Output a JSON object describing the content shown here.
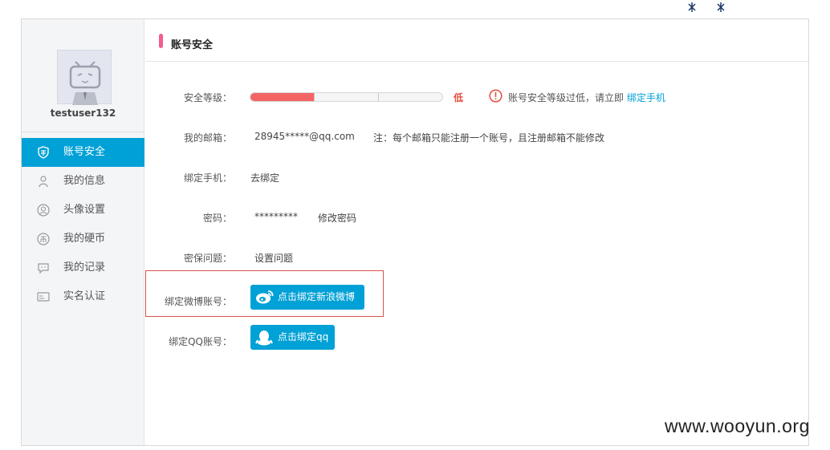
{
  "sidebar": {
    "username": "testuser132",
    "items": [
      {
        "label": "账号安全",
        "icon": "shield-icon",
        "active": true
      },
      {
        "label": "我的信息",
        "icon": "person-icon",
        "active": false
      },
      {
        "label": "头像设置",
        "icon": "avatar-icon",
        "active": false
      },
      {
        "label": "我的硬币",
        "icon": "coin-icon",
        "active": false
      },
      {
        "label": "我的记录",
        "icon": "chat-icon",
        "active": false
      },
      {
        "label": "实名认证",
        "icon": "id-card-icon",
        "active": false
      }
    ]
  },
  "header": {
    "title": "账号安全"
  },
  "security": {
    "level_label": "安全等级：",
    "level_value": "低",
    "level_fraction": 0.33,
    "warning_text": "账号安全等级过低，请立即",
    "warning_link": "绑定手机"
  },
  "email": {
    "label": "我的邮箱：",
    "value": "28945*****@qq.com",
    "note": "注：每个邮箱只能注册一个账号，且注册邮箱不能修改"
  },
  "phone": {
    "label": "绑定手机：",
    "link": "去绑定"
  },
  "password": {
    "label": "密码：",
    "value": "*********",
    "link": "修改密码"
  },
  "question": {
    "label": "密保问题：",
    "link": "设置问题"
  },
  "weibo": {
    "label": "绑定微博账号：",
    "button": "点击绑定新浪微博"
  },
  "qq": {
    "label": "绑定QQ账号：",
    "button": "点击绑定qq"
  },
  "watermark": "www.wooyun.org",
  "colors": {
    "accent": "#00a1d6",
    "pink": "#f25d8e",
    "danger": "#f36565"
  }
}
